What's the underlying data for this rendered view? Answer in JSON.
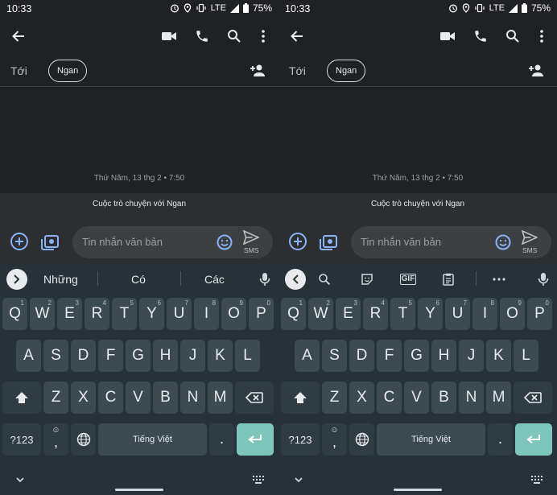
{
  "status": {
    "time": "10:33",
    "network": "LTE",
    "battery": "75%"
  },
  "recipient": {
    "to_label": "Tới",
    "chip": "Ngan"
  },
  "conversation": {
    "date": "Thứ Năm, 13 thg 2 • 7:50",
    "banner": "Cuộc trò chuyện với Ngan"
  },
  "composer": {
    "placeholder": "Tin nhắn văn bản",
    "send_sub": "SMS"
  },
  "suggestions": [
    "Những",
    "Có",
    "Các"
  ],
  "keyboard": {
    "row1": [
      {
        "k": "Q",
        "h": "1"
      },
      {
        "k": "W",
        "h": "2"
      },
      {
        "k": "E",
        "h": "3"
      },
      {
        "k": "R",
        "h": "4"
      },
      {
        "k": "T",
        "h": "5"
      },
      {
        "k": "Y",
        "h": "6"
      },
      {
        "k": "U",
        "h": "7"
      },
      {
        "k": "I",
        "h": "8"
      },
      {
        "k": "O",
        "h": "9"
      },
      {
        "k": "P",
        "h": "0"
      }
    ],
    "row2": [
      "A",
      "S",
      "D",
      "F",
      "G",
      "H",
      "J",
      "K",
      "L"
    ],
    "row3": [
      "Z",
      "X",
      "C",
      "V",
      "B",
      "N",
      "M"
    ],
    "symbols": "?123",
    "comma": ",",
    "space": "Tiếng Việt",
    "period": "."
  },
  "colors": {
    "accent": "#7ec5bb",
    "keyboard_bg": "#263238",
    "key_bg": "#3c4a52",
    "app_bg": "#202124"
  }
}
